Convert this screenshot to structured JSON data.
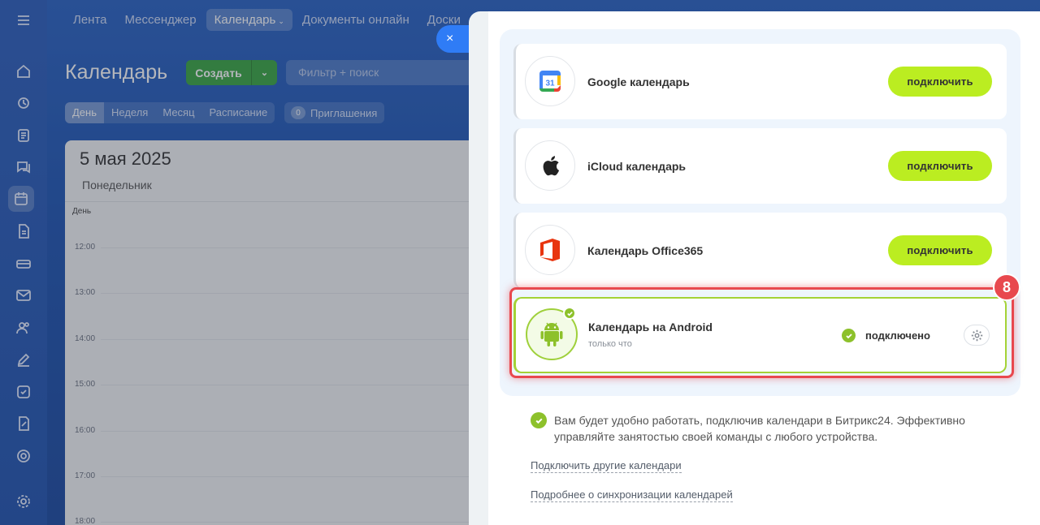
{
  "topnav": {
    "items": [
      "Лента",
      "Мессенджер",
      "Календарь",
      "Документы онлайн",
      "Доски"
    ]
  },
  "calendar": {
    "title": "Календарь",
    "create_label": "Создать",
    "filter_placeholder": "Фильтр + поиск",
    "views": [
      "День",
      "Неделя",
      "Месяц",
      "Расписание"
    ],
    "invites_count": "0",
    "invites_label": "Приглашения",
    "date": "5 мая 2025",
    "weekday": "Понедельник",
    "column_label": "День",
    "hours": [
      "12:00",
      "13:00",
      "14:00",
      "15:00",
      "16:00",
      "17:00",
      "18:00"
    ]
  },
  "slider": {
    "close_label": "×",
    "connect_label": "подключить",
    "calendars": [
      {
        "name": "Google календарь",
        "icon": "google-calendar-icon"
      },
      {
        "name": "iCloud календарь",
        "icon": "apple-icon"
      },
      {
        "name": "Календарь Office365",
        "icon": "office365-icon"
      }
    ],
    "android": {
      "name": "Календарь на Android",
      "sub": "только что",
      "status": "подключено",
      "icon": "android-icon"
    },
    "step_number": "8",
    "hint": "Вам будет удобно работать, подключив календари в Битрикс24. Эффективно управляйте занятостью своей команды с любого устройства.",
    "link_other": "Подключить другие календари",
    "link_more": "Подробнее о синхронизации календарей"
  },
  "colors": {
    "accent_green": "#bbed21",
    "success": "#8dc12b",
    "highlight_red": "#e8484e",
    "close_blue": "#2f7cf6"
  }
}
